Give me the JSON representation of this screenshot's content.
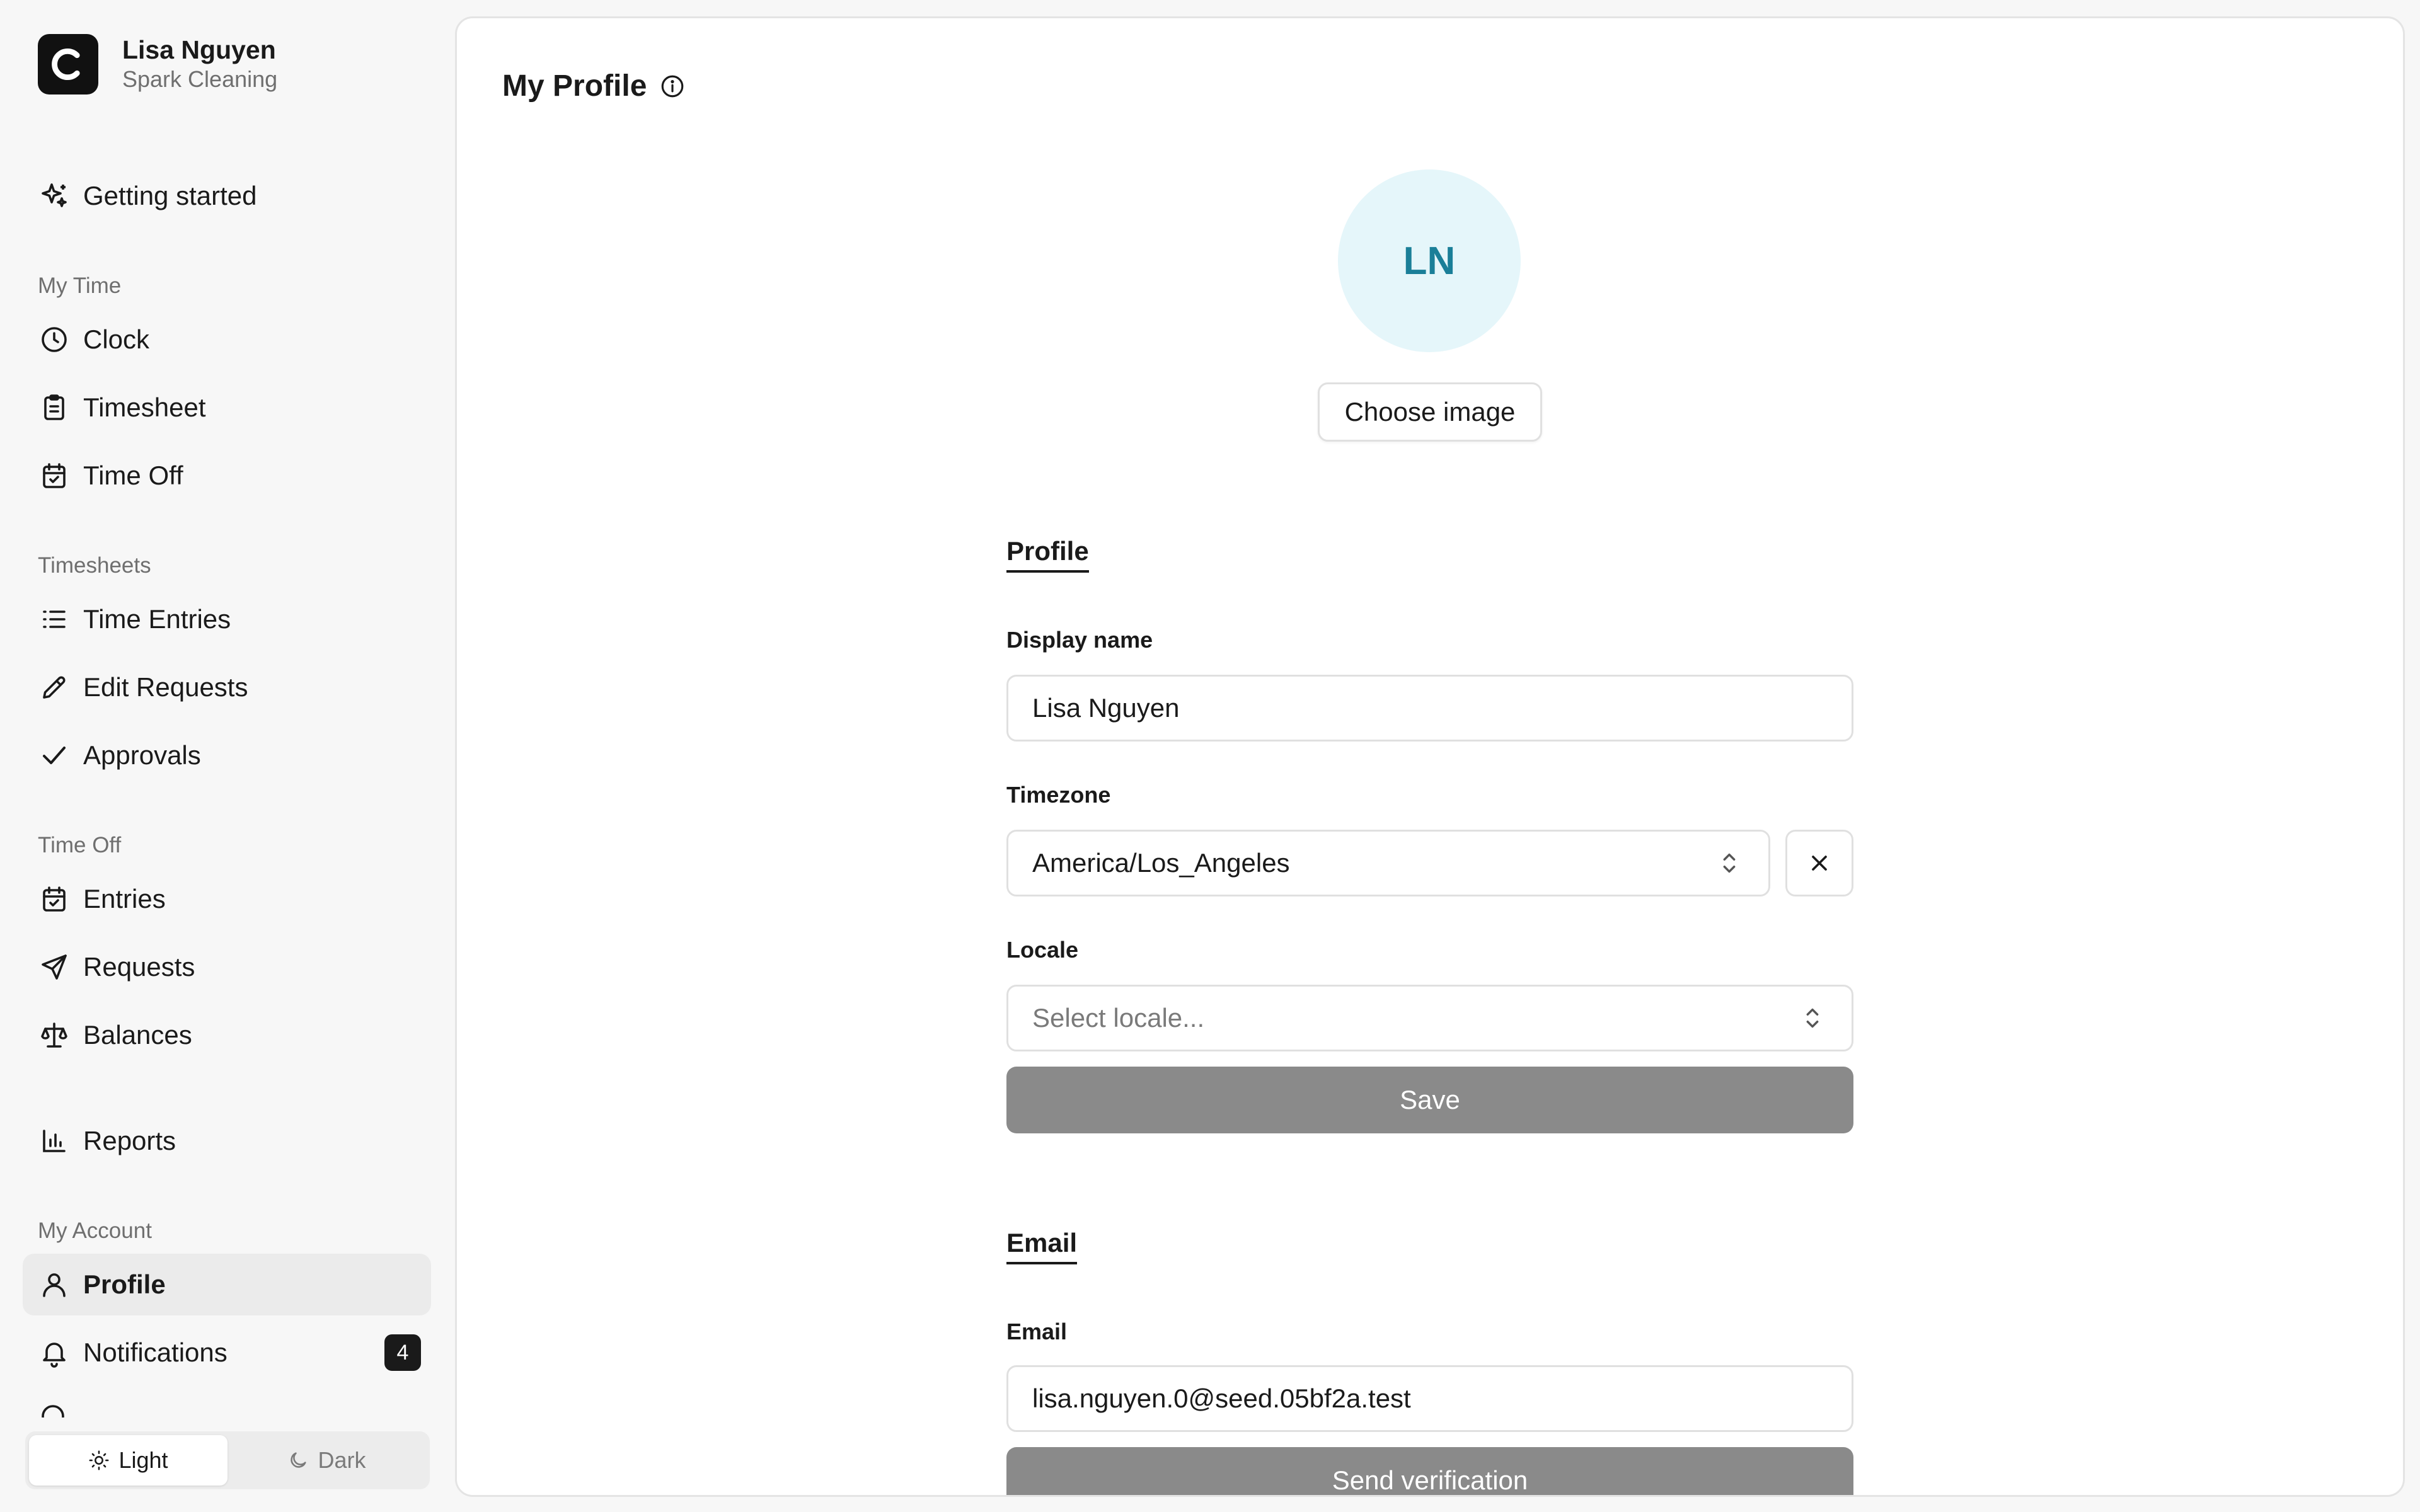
{
  "user": {
    "name": "Lisa Nguyen",
    "organization": "Spark Cleaning",
    "brand_icon": "brand-c-logo",
    "brand_letter": "C"
  },
  "sidebar": {
    "getting_started": {
      "label": "Getting started",
      "icon": "sparkles-icon"
    },
    "sections": [
      {
        "title": "My Time",
        "items": [
          {
            "label": "Clock",
            "icon": "clock-icon"
          },
          {
            "label": "Timesheet",
            "icon": "clipboard-icon"
          },
          {
            "label": "Time Off",
            "icon": "calendar-check-icon"
          }
        ]
      },
      {
        "title": "Timesheets",
        "items": [
          {
            "label": "Time Entries",
            "icon": "list-icon"
          },
          {
            "label": "Edit Requests",
            "icon": "pencil-icon"
          },
          {
            "label": "Approvals",
            "icon": "check-icon"
          }
        ]
      },
      {
        "title": "Time Off",
        "items": [
          {
            "label": "Entries",
            "icon": "calendar-check-icon"
          },
          {
            "label": "Requests",
            "icon": "send-icon"
          },
          {
            "label": "Balances",
            "icon": "scale-icon"
          }
        ]
      }
    ],
    "reports": {
      "label": "Reports",
      "icon": "bar-chart-icon"
    },
    "account_section": {
      "title": "My Account",
      "profile": {
        "label": "Profile",
        "icon": "user-icon",
        "active": true
      },
      "notifications": {
        "label": "Notifications",
        "icon": "bell-icon",
        "badge": "4"
      },
      "next_clipped": {
        "icon": "key-icon"
      }
    },
    "theme": {
      "light_label": "Light",
      "dark_label": "Dark",
      "selected": "Light"
    }
  },
  "main": {
    "title": "My Profile",
    "title_icon": "info-icon",
    "avatar_initials": "LN",
    "choose_image_label": "Choose image",
    "profile_section": {
      "title": "Profile",
      "display_name_label": "Display name",
      "display_name_value": "Lisa Nguyen",
      "timezone_label": "Timezone",
      "timezone_value": "America/Los_Angeles",
      "locale_label": "Locale",
      "locale_placeholder": "Select locale...",
      "save_label": "Save"
    },
    "email_section": {
      "title": "Email",
      "email_label": "Email",
      "email_value": "lisa.nguyen.0@seed.05bf2a.test",
      "send_verification_label": "Send verification"
    }
  },
  "colors": {
    "accent_dark": "#1a1a1a",
    "avatar_bg": "#e5f6fa",
    "avatar_text": "#1a7f98",
    "disabled_button": "#8a8a8a"
  }
}
